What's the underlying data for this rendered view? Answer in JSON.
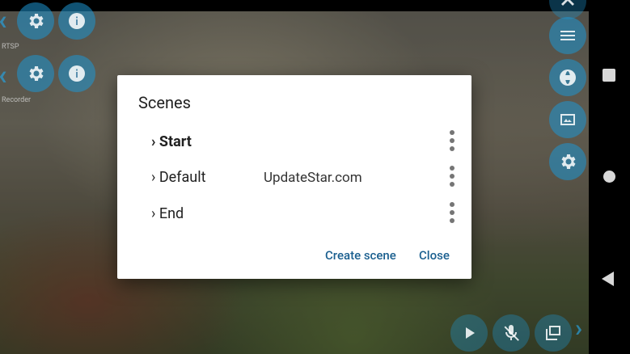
{
  "overlay": {
    "rtsp_label": "RTSP",
    "recorder_label": "Recorder"
  },
  "dialog": {
    "title": "Scenes",
    "scenes": [
      {
        "label": "› Start",
        "bold": true
      },
      {
        "label": "› Default",
        "bold": false
      },
      {
        "label": "› End",
        "bold": false
      }
    ],
    "watermark": "UpdateStar.com",
    "create_label": "Create scene",
    "close_label": "Close"
  },
  "icons": {
    "left": [
      "chevron-left-icon",
      "gear-icon",
      "info-icon"
    ],
    "right": [
      "chevron-up-icon",
      "menu-icon",
      "globe-icon",
      "screen-cast-icon",
      "gear-icon"
    ],
    "bottom": [
      "play-icon",
      "mic-off-icon",
      "layers-icon",
      "chevron-right-icon"
    ]
  },
  "colors": {
    "accent": "#1e96d2",
    "button_text": "#1a5f8f"
  }
}
